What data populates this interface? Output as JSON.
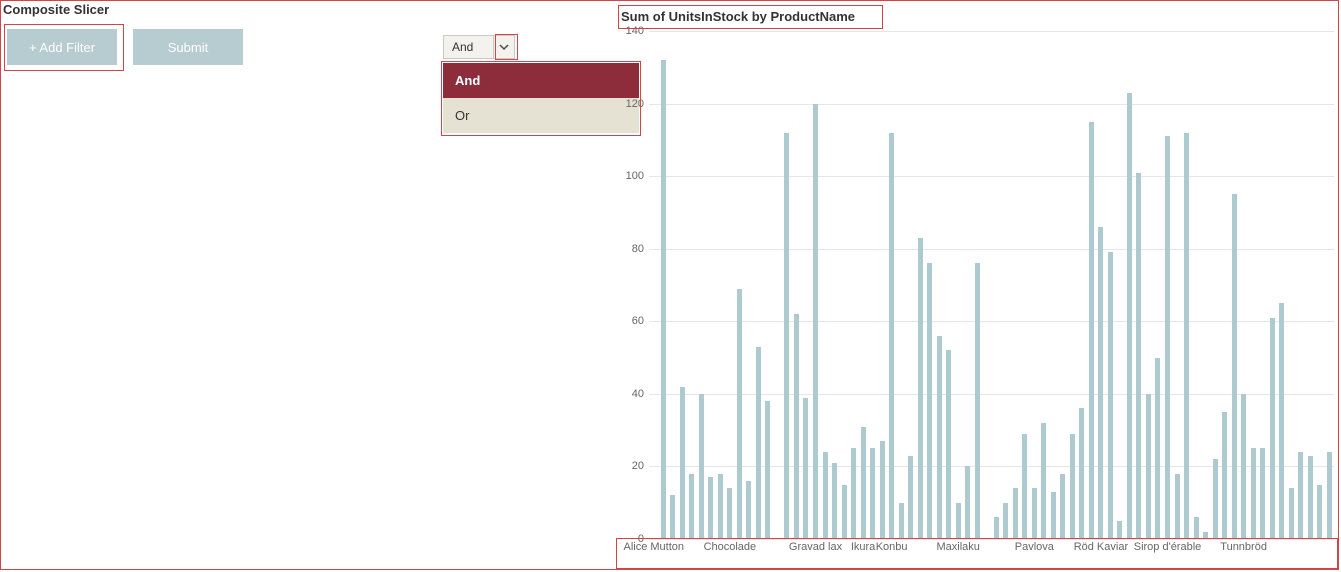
{
  "slicer": {
    "title": "Composite Slicer",
    "add_filter_label": "+ Add Filter",
    "submit_label": "Submit"
  },
  "operator": {
    "selected": "And",
    "options": [
      "And",
      "Or"
    ]
  },
  "chart": {
    "title": "Sum of UnitsInStock by ProductName"
  },
  "chart_data": {
    "type": "bar",
    "ylabel": "",
    "xlabel": "",
    "ylim": [
      0,
      140
    ],
    "y_ticks": [
      0,
      20,
      40,
      60,
      80,
      100,
      120,
      140
    ],
    "x_visible_labels": [
      {
        "index": 0,
        "label": "Alice Mutton"
      },
      {
        "index": 8,
        "label": "Chocolade"
      },
      {
        "index": 17,
        "label": "Gravad lax"
      },
      {
        "index": 22,
        "label": "Ikura"
      },
      {
        "index": 25,
        "label": "Konbu"
      },
      {
        "index": 32,
        "label": "Maxilaku"
      },
      {
        "index": 40,
        "label": "Pavlova"
      },
      {
        "index": 47,
        "label": "Röd Kaviar"
      },
      {
        "index": 54,
        "label": "Sirop d'érable"
      },
      {
        "index": 62,
        "label": "Tunnbröd"
      }
    ],
    "values": [
      0,
      132,
      12,
      42,
      18,
      40,
      17,
      18,
      14,
      69,
      16,
      53,
      38,
      0,
      112,
      62,
      39,
      120,
      24,
      21,
      15,
      25,
      31,
      25,
      27,
      112,
      10,
      23,
      83,
      76,
      56,
      52,
      10,
      20,
      76,
      0,
      6,
      10,
      14,
      29,
      14,
      32,
      13,
      18,
      29,
      36,
      115,
      86,
      79,
      5,
      123,
      101,
      40,
      50,
      111,
      18,
      112,
      6,
      2,
      22,
      35,
      95,
      40,
      25,
      25,
      61,
      65,
      14,
      24,
      23,
      15,
      24
    ]
  }
}
